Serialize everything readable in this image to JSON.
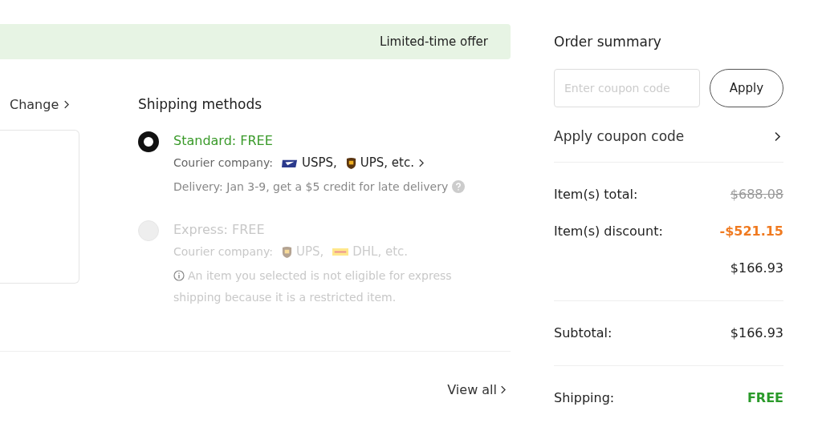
{
  "banner": {
    "text": "Limited-time offer"
  },
  "address": {
    "change_link": "Change"
  },
  "shipping": {
    "title": "Shipping methods",
    "options": [
      {
        "name": "Standard: FREE",
        "selected": true,
        "disabled": false,
        "courier_label": "Courier company:",
        "carriers": [
          {
            "kind": "usps",
            "name": "USPS,"
          },
          {
            "kind": "ups",
            "name": "UPS, etc."
          }
        ],
        "more": true,
        "note": {
          "kind": "delivery",
          "text": "Delivery: Jan 3-9, get a $5 credit for late delivery"
        }
      },
      {
        "name": "Express: FREE",
        "selected": false,
        "disabled": true,
        "courier_label": "Courier company:",
        "carriers": [
          {
            "kind": "ups",
            "name": "UPS,"
          },
          {
            "kind": "dhl",
            "name": "DHL, etc."
          }
        ],
        "more": false,
        "note": {
          "kind": "info",
          "text": "An item you selected is not eligible for express shipping because it is a restricted item."
        }
      }
    ]
  },
  "items": {
    "view_all": "View all"
  },
  "summary": {
    "title": "Order summary",
    "coupon": {
      "placeholder": "Enter coupon code",
      "button": "Apply"
    },
    "coupon_link": "Apply coupon code",
    "sections": [
      [
        {
          "label": "Item(s) total:",
          "value": "$688.08",
          "kind": "struck"
        },
        {
          "label": "Item(s) discount:",
          "value": "-$521.15",
          "kind": "discount"
        },
        {
          "value": "$166.93",
          "kind": "plain"
        }
      ],
      [
        {
          "label": "Subtotal:",
          "value": "$166.93",
          "kind": "plain"
        }
      ],
      [
        {
          "label": "Shipping:",
          "value": "FREE",
          "kind": "free"
        }
      ]
    ]
  }
}
